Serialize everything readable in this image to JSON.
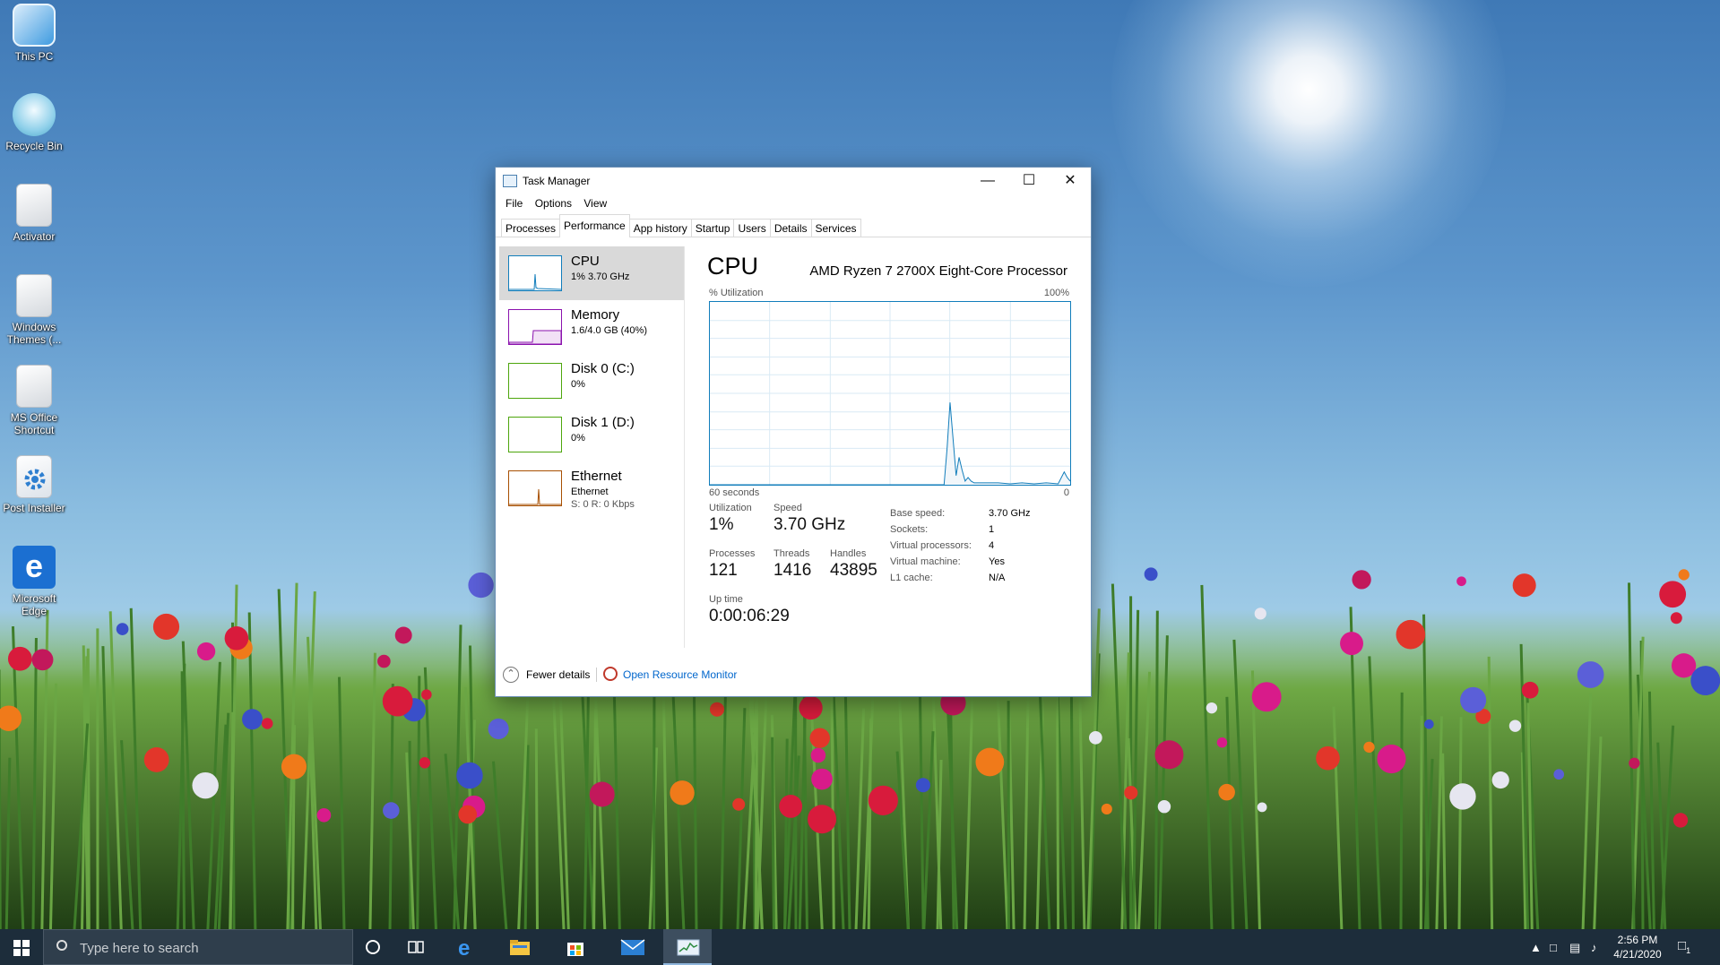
{
  "desktop": {
    "icons": [
      {
        "label": "This PC",
        "icon": "computer-icon"
      },
      {
        "label": "Recycle Bin",
        "icon": "recycle-bin-icon"
      },
      {
        "label": "Activator",
        "icon": "file-icon"
      },
      {
        "label": "Windows Themes (...",
        "icon": "file-icon"
      },
      {
        "label": "MS Office Shortcut",
        "icon": "file-shortcut-icon"
      },
      {
        "label": "Post Installer",
        "icon": "gear-icon"
      },
      {
        "label": "Microsoft Edge",
        "icon": "edge-icon"
      }
    ]
  },
  "window": {
    "title": "Task Manager",
    "menu": [
      "File",
      "Options",
      "View"
    ],
    "tabs": [
      "Processes",
      "Performance",
      "App history",
      "Startup",
      "Users",
      "Details",
      "Services"
    ],
    "active_tab": "Performance",
    "resources": [
      {
        "name": "CPU",
        "sub": "1% 3.70 GHz",
        "color": "#117dbb",
        "selected": true
      },
      {
        "name": "Memory",
        "sub": "1.6/4.0 GB (40%)",
        "color": "#8b12ae"
      },
      {
        "name": "Disk 0 (C:)",
        "sub": "0%",
        "color": "#4da60c"
      },
      {
        "name": "Disk 1 (D:)",
        "sub": "0%",
        "color": "#4da60c"
      },
      {
        "name": "Ethernet",
        "sub": "Ethernet",
        "sub2": "S: 0 R: 0 Kbps",
        "color": "#a74f01"
      }
    ],
    "detail": {
      "title": "CPU",
      "model": "AMD Ryzen 7 2700X Eight-Core Processor",
      "util_label": "% Utilization",
      "util_max": "100%",
      "x_left": "60 seconds",
      "x_right": "0",
      "stats": {
        "utilization_label": "Utilization",
        "utilization": "1%",
        "speed_label": "Speed",
        "speed": "3.70 GHz",
        "processes_label": "Processes",
        "processes": "121",
        "threads_label": "Threads",
        "threads": "1416",
        "handles_label": "Handles",
        "handles": "43895",
        "uptime_label": "Up time",
        "uptime": "0:00:06:29"
      },
      "props": [
        {
          "k": "Base speed:",
          "v": "3.70 GHz"
        },
        {
          "k": "Sockets:",
          "v": "1"
        },
        {
          "k": "Virtual processors:",
          "v": "4"
        },
        {
          "k": "Virtual machine:",
          "v": "Yes"
        },
        {
          "k": "L1 cache:",
          "v": "N/A"
        }
      ]
    },
    "footer": {
      "fewer": "Fewer details",
      "resmon": "Open Resource Monitor"
    }
  },
  "chart_data": {
    "type": "line",
    "x_range": [
      60,
      0
    ],
    "ylim": [
      0,
      100
    ],
    "grid": true,
    "series": [
      {
        "color": "#117dbb",
        "x": [
          60,
          40,
          21,
          20.5,
          20,
          19.5,
          19,
          18.5,
          18,
          17.5,
          17,
          16.5,
          16,
          15.5,
          15,
          14,
          12,
          10,
          8,
          6,
          4,
          2,
          1,
          0.5,
          0
        ],
        "y": [
          0,
          0,
          0,
          20,
          45,
          25,
          5,
          15,
          8,
          2,
          4,
          2,
          1,
          1,
          1,
          1,
          1,
          0.5,
          1,
          0.5,
          1,
          0.5,
          7,
          4,
          2
        ]
      }
    ]
  },
  "taskbar": {
    "search_placeholder": "Type here to search",
    "time": "2:56 PM",
    "date": "4/21/2020",
    "notification_count": "1"
  }
}
